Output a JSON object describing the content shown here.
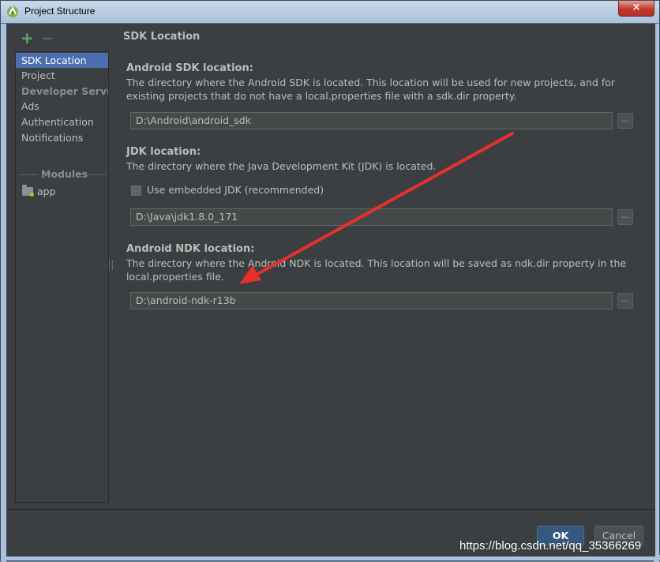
{
  "window": {
    "title": "Project Structure",
    "close_glyph": "×"
  },
  "toolbar": {
    "add_glyph": "+",
    "remove_glyph": "−"
  },
  "sidebar": {
    "items": [
      {
        "label": "SDK Location"
      },
      {
        "label": "Project"
      },
      {
        "label": "Developer Servi..."
      },
      {
        "label": "Ads"
      },
      {
        "label": "Authentication"
      },
      {
        "label": "Notifications"
      }
    ],
    "modules_header": "Modules",
    "module_item": "app"
  },
  "main": {
    "section_title": "SDK Location",
    "sdk": {
      "label": "Android SDK location:",
      "description": "The directory where the Android SDK is located. This location will be used for new projects, and for existing projects that do not have a local.properties file with a sdk.dir property.",
      "path": "D:\\Android\\android_sdk"
    },
    "jdk": {
      "label": "JDK location:",
      "description": "The directory where the Java Development Kit (JDK) is located.",
      "checkbox_label": "Use embedded JDK (recommended)",
      "checkbox_checked": false,
      "path": "D:\\Java\\jdk1.8.0_171"
    },
    "ndk": {
      "label": "Android NDK location:",
      "description": "The directory where the Android NDK is located. This location will be saved as ndk.dir property in the local.properties file.",
      "path": "D:\\android-ndk-r13b"
    },
    "browse_label": "..."
  },
  "footer": {
    "ok_label": "OK",
    "cancel_label": "Cancel"
  },
  "watermark": "https://blog.csdn.net/qq_35366269",
  "colors": {
    "accent": "#4b6eaf",
    "annotation_arrow": "#e8302a",
    "background": "#3c3f41"
  }
}
